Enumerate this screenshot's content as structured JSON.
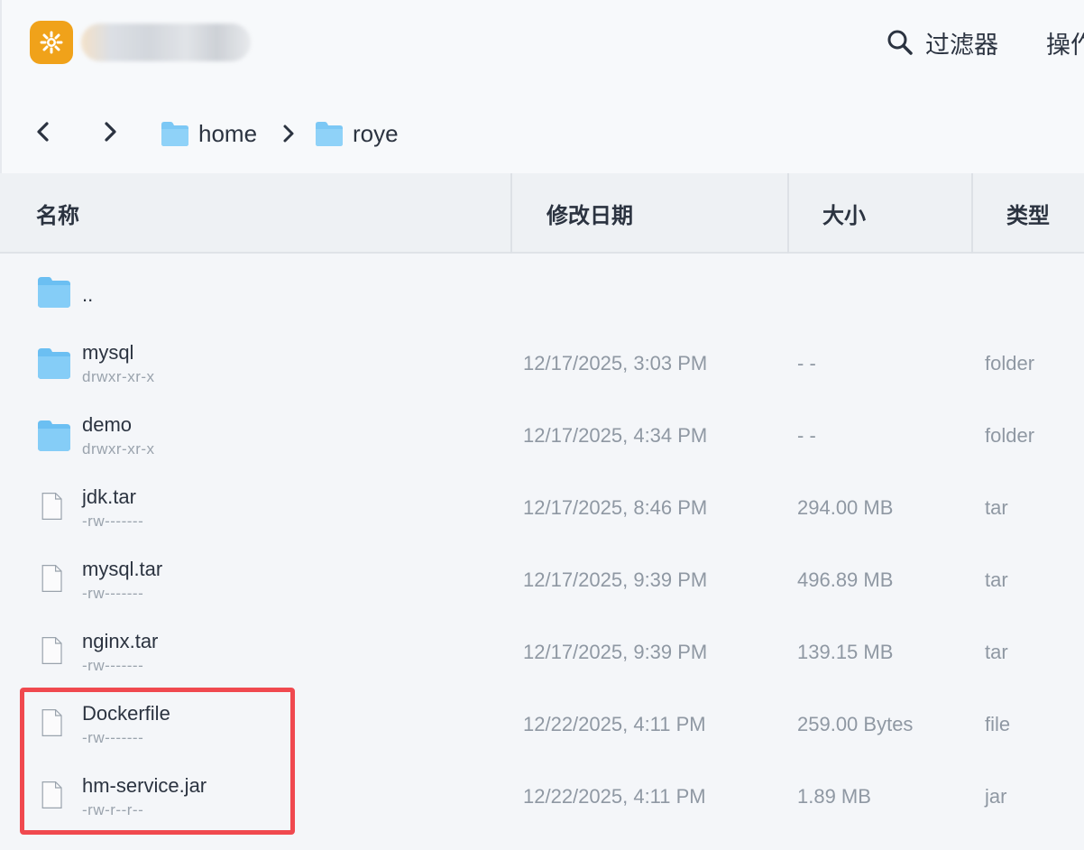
{
  "toolbar": {
    "filter_label": "过滤器",
    "ops_label": "操作"
  },
  "breadcrumb": {
    "items": [
      "home",
      "roye"
    ]
  },
  "table": {
    "columns": [
      "名称",
      "修改日期",
      "大小",
      "类型"
    ],
    "rows": [
      {
        "name": "..",
        "perm": "",
        "date": "",
        "size": "",
        "type": "",
        "kind": "folder"
      },
      {
        "name": "mysql",
        "perm": "drwxr-xr-x",
        "date": "12/17/2025, 3:03 PM",
        "size": "- -",
        "type": "folder",
        "kind": "folder"
      },
      {
        "name": "demo",
        "perm": "drwxr-xr-x",
        "date": "12/17/2025, 4:34 PM",
        "size": "- -",
        "type": "folder",
        "kind": "folder"
      },
      {
        "name": "jdk.tar",
        "perm": "-rw-------",
        "date": "12/17/2025, 8:46 PM",
        "size": "294.00 MB",
        "type": "tar",
        "kind": "file"
      },
      {
        "name": "mysql.tar",
        "perm": "-rw-------",
        "date": "12/17/2025, 9:39 PM",
        "size": "496.89 MB",
        "type": "tar",
        "kind": "file"
      },
      {
        "name": "nginx.tar",
        "perm": "-rw-------",
        "date": "12/17/2025, 9:39 PM",
        "size": "139.15 MB",
        "type": "tar",
        "kind": "file"
      },
      {
        "name": "Dockerfile",
        "perm": "-rw-------",
        "date": "12/22/2025, 4:11 PM",
        "size": "259.00 Bytes",
        "type": "file",
        "kind": "file"
      },
      {
        "name": "hm-service.jar",
        "perm": "-rw-r--r--",
        "date": "12/22/2025, 4:11 PM",
        "size": "1.89 MB",
        "type": "jar",
        "kind": "file"
      }
    ]
  },
  "colors": {
    "accent": "#f0a21a",
    "folder": "#7cc8f5",
    "highlight": "#f0494f"
  },
  "icons": {
    "logo": "app-logo-icon",
    "filter": "search-icon",
    "back": "chevron-left-icon",
    "forward": "chevron-right-icon",
    "folder": "folder-icon",
    "file": "file-icon"
  }
}
